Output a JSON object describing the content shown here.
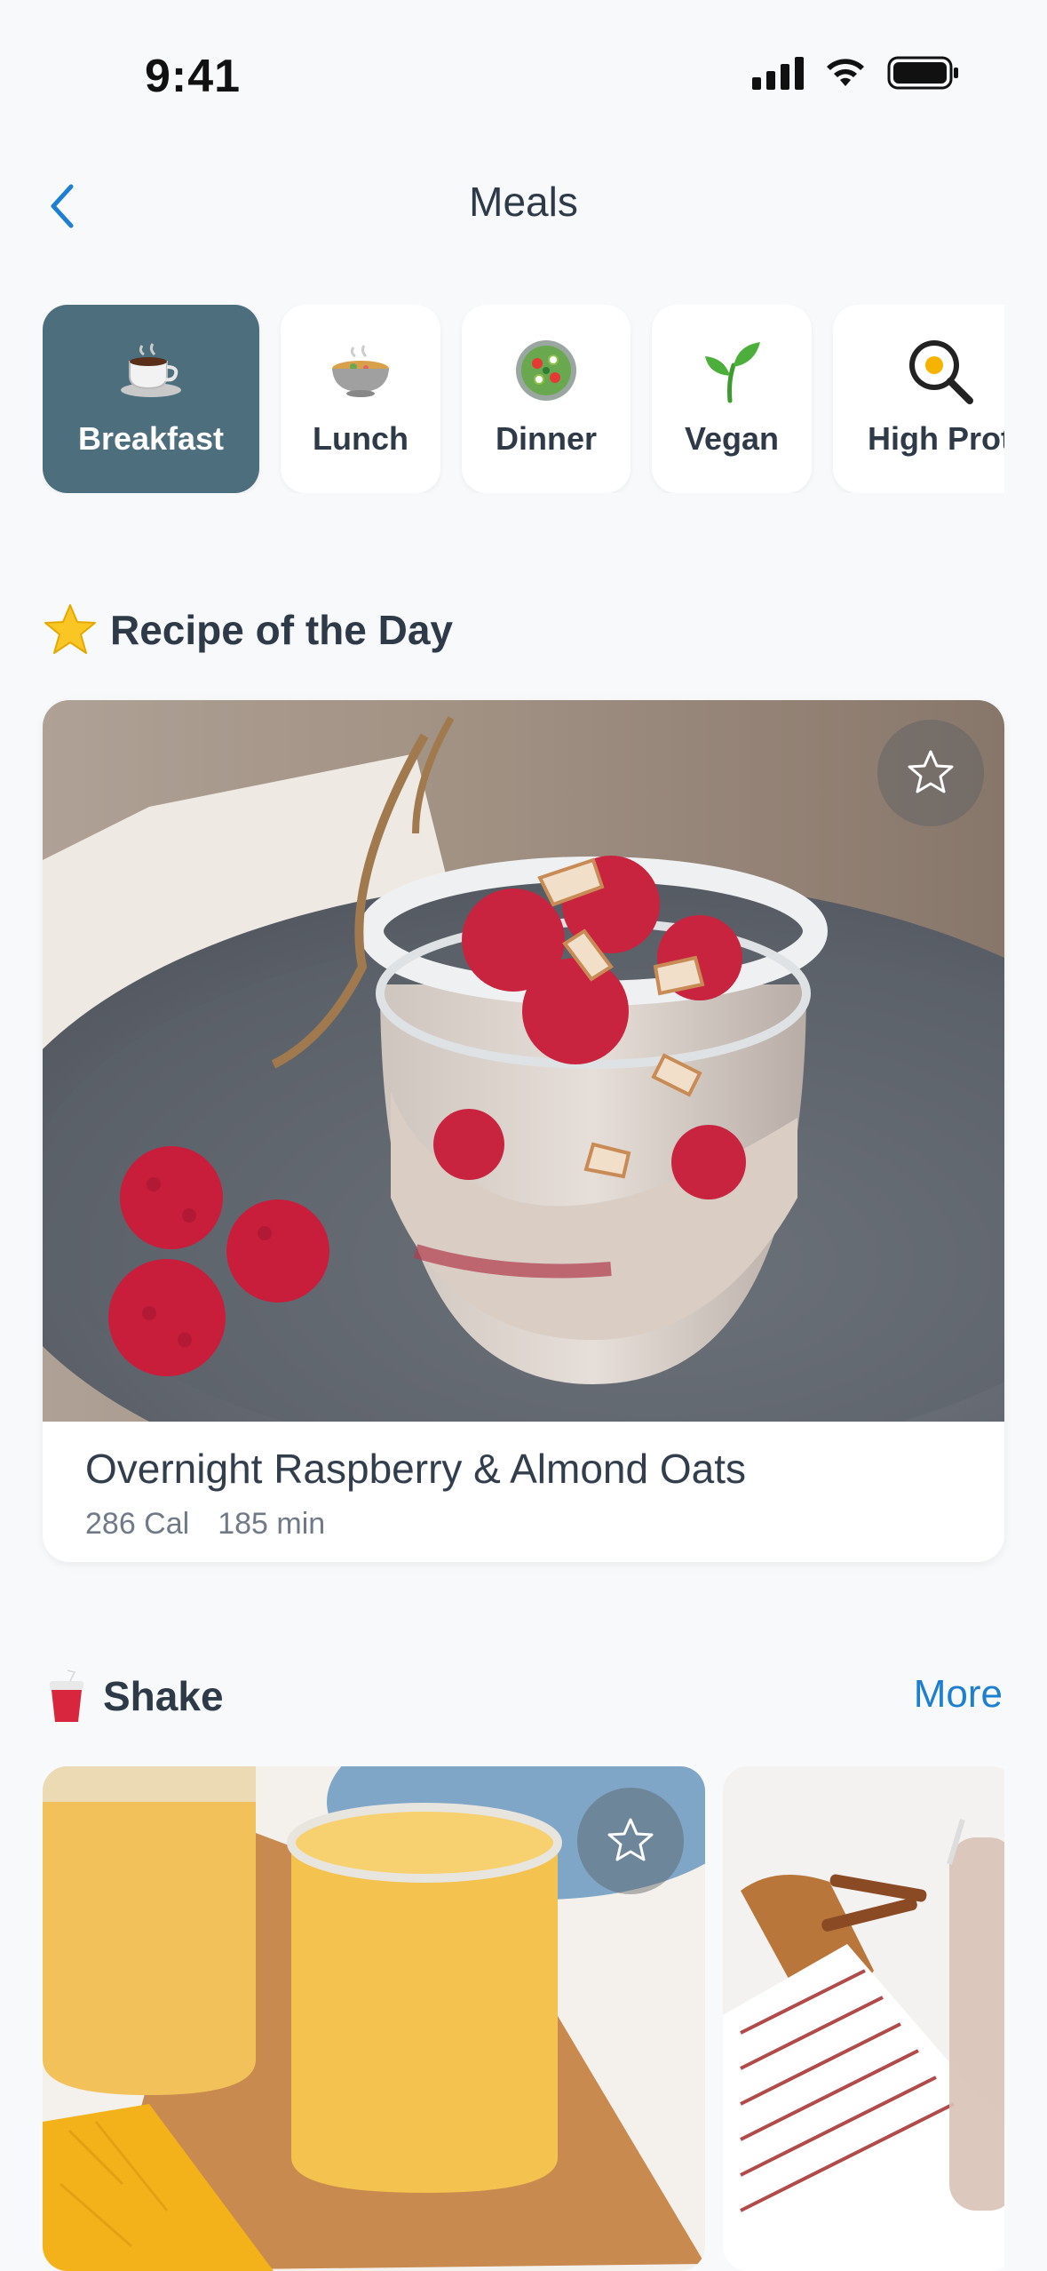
{
  "status_bar": {
    "time": "9:41"
  },
  "nav": {
    "title": "Meals"
  },
  "categories": [
    {
      "label": "Breakfast",
      "icon": "coffee-cup-icon",
      "active": true
    },
    {
      "label": "Lunch",
      "icon": "soup-bowl-icon",
      "active": false
    },
    {
      "label": "Dinner",
      "icon": "salad-bowl-icon",
      "active": false
    },
    {
      "label": "Vegan",
      "icon": "seedling-icon",
      "active": false
    },
    {
      "label": "High Prot",
      "icon": "frying-pan-egg-icon",
      "active": false
    }
  ],
  "recipe_of_day": {
    "heading": "Recipe of the Day",
    "heading_icon": "star-icon",
    "name": "Overnight Raspberry & Almond Oats",
    "calories": "286 Cal",
    "time": "185 min"
  },
  "shake": {
    "heading": "Shake",
    "heading_icon": "cup-with-straw-icon",
    "more_label": "More"
  },
  "colors": {
    "accent": "#1d7fcf",
    "active_chip": "#4d6e7d",
    "background": "#f8f9fa",
    "text": "#2f3a48"
  }
}
